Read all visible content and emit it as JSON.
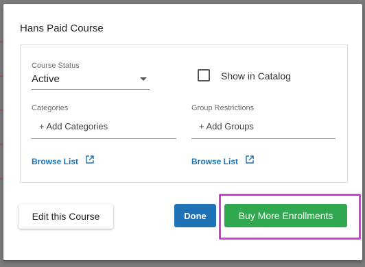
{
  "modal": {
    "title": "Hans Paid Course",
    "course_status": {
      "label": "Course Status",
      "value": "Active"
    },
    "show_in_catalog": {
      "label": "Show in Catalog",
      "checked": false
    },
    "categories": {
      "label": "Categories",
      "add_text": "+ Add Categories",
      "browse_label": "Browse List"
    },
    "group_restrictions": {
      "label": "Group Restrictions",
      "add_text": "+ Add Groups",
      "browse_label": "Browse List"
    },
    "buttons": {
      "edit": "Edit this Course",
      "done": "Done",
      "buy": "Buy More Enrollments"
    }
  },
  "colors": {
    "link_blue": "#1a73b8",
    "done_blue": "#1f72b6",
    "buy_green": "#2fa84f",
    "highlight_magenta": "#d23ed4"
  },
  "icons": [
    "external-link-icon",
    "chevron-down-icon",
    "checkbox-icon"
  ]
}
